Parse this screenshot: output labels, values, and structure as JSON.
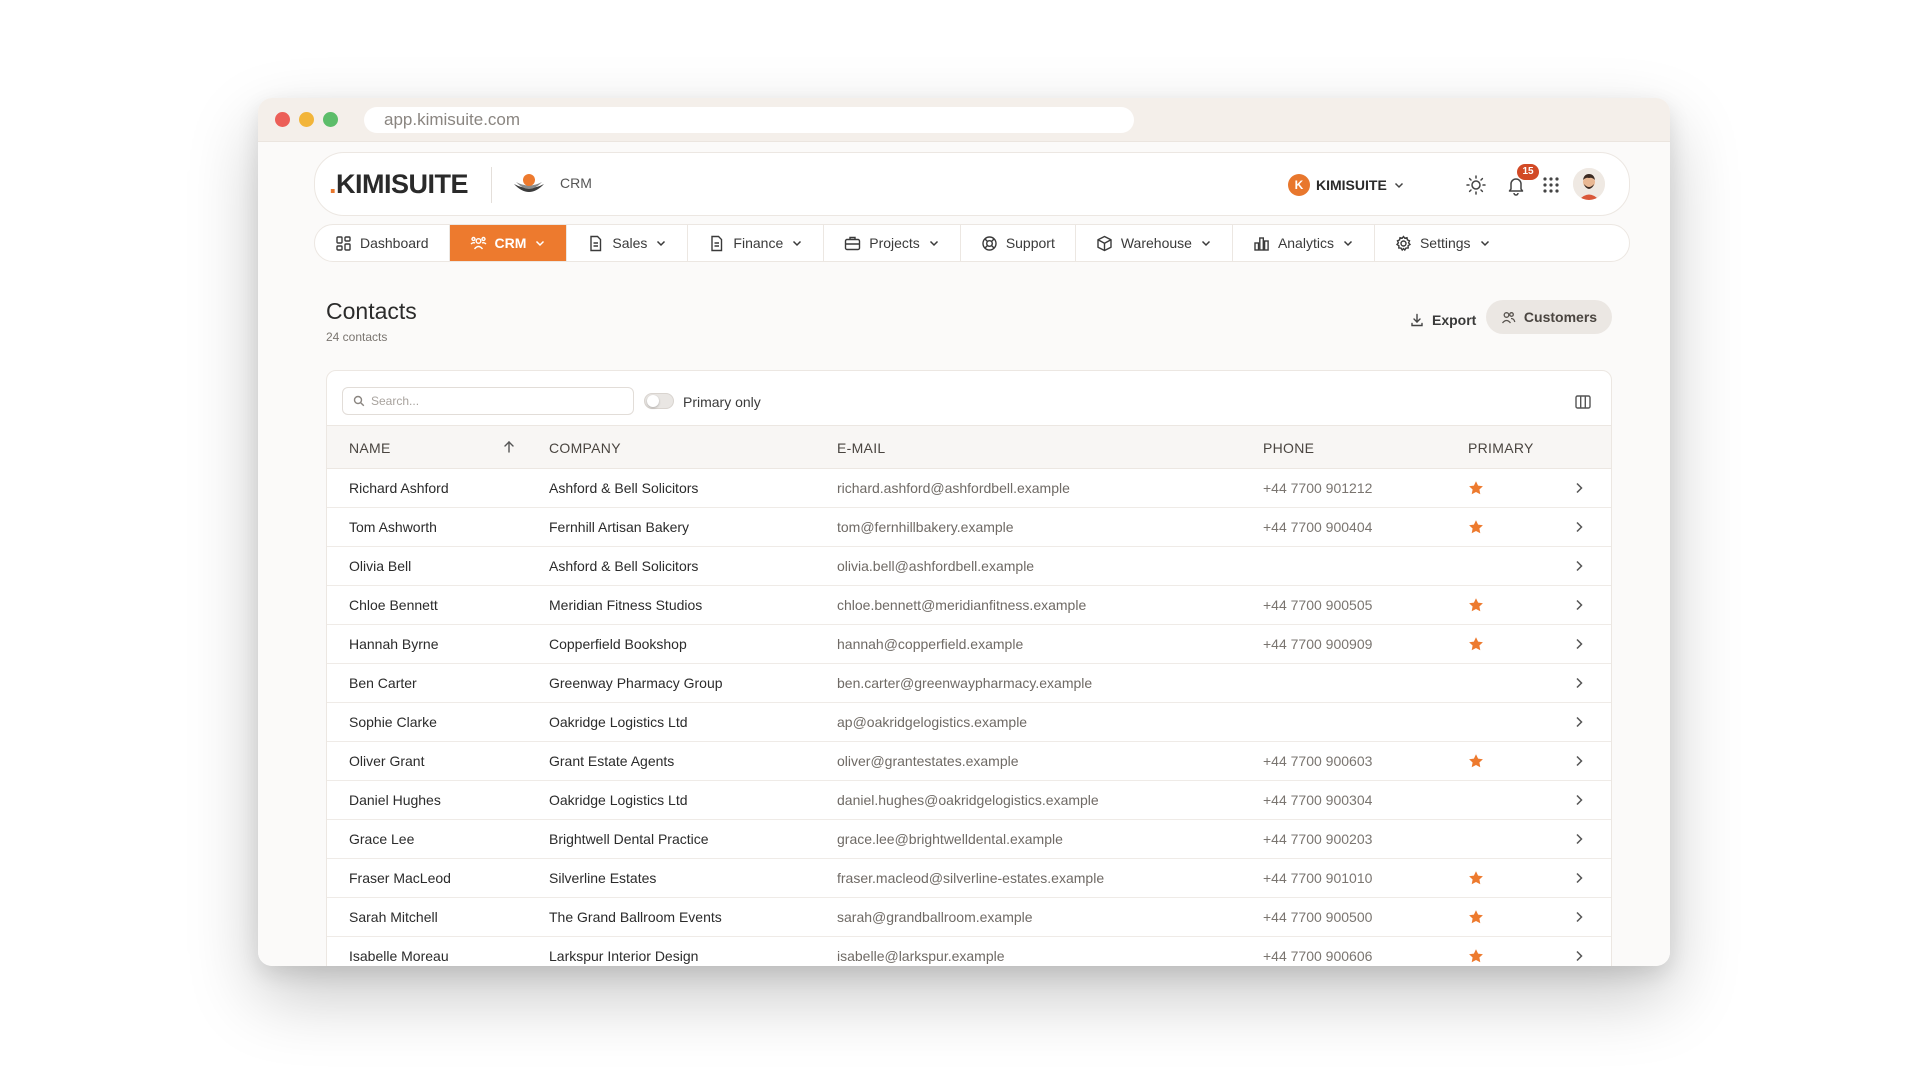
{
  "browser": {
    "url": "app.kimisuite.com"
  },
  "header": {
    "logo_dot": ".",
    "logo_text": "KIMISUITE",
    "module_label": "CRM",
    "tenant_initial": "K",
    "tenant_name": "KIMISUITE",
    "notification_count": "15",
    "icons": [
      "sun-icon",
      "bell-icon",
      "apps-grid-icon"
    ]
  },
  "nav": {
    "items": [
      {
        "label": "Dashboard",
        "icon": "dashboard-icon"
      },
      {
        "label": "CRM",
        "icon": "people-icon"
      },
      {
        "label": "Sales",
        "icon": "document-icon"
      },
      {
        "label": "Finance",
        "icon": "document-icon"
      },
      {
        "label": "Projects",
        "icon": "briefcase-icon"
      },
      {
        "label": "Support",
        "icon": "lifebuoy-icon"
      },
      {
        "label": "Warehouse",
        "icon": "box-icon"
      },
      {
        "label": "Analytics",
        "icon": "bar-chart-icon"
      },
      {
        "label": "Settings",
        "icon": "gear-icon"
      }
    ],
    "active": "CRM"
  },
  "page": {
    "title": "Contacts",
    "subtitle": "24 contacts",
    "export_label": "Export",
    "customers_label": "Customers"
  },
  "toolbar": {
    "search_placeholder": "Search...",
    "search_value": "",
    "toggle_label": "Primary only",
    "toggle_on": false
  },
  "table": {
    "columns": [
      "NAME",
      "COMPANY",
      "E-MAIL",
      "PHONE",
      "PRIMARY"
    ],
    "sort": {
      "column": "NAME",
      "direction": "asc"
    },
    "rows": [
      {
        "name": "Richard Ashford",
        "company": "Ashford & Bell Solicitors",
        "email": "richard.ashford@ashfordbell.example",
        "phone": "+44 7700 901212",
        "primary": true
      },
      {
        "name": "Tom Ashworth",
        "company": "Fernhill Artisan Bakery",
        "email": "tom@fernhillbakery.example",
        "phone": "+44 7700 900404",
        "primary": true
      },
      {
        "name": "Olivia Bell",
        "company": "Ashford & Bell Solicitors",
        "email": "olivia.bell@ashfordbell.example",
        "phone": "",
        "primary": false
      },
      {
        "name": "Chloe Bennett",
        "company": "Meridian Fitness Studios",
        "email": "chloe.bennett@meridianfitness.example",
        "phone": "+44 7700 900505",
        "primary": true
      },
      {
        "name": "Hannah Byrne",
        "company": "Copperfield Bookshop",
        "email": "hannah@copperfield.example",
        "phone": "+44 7700 900909",
        "primary": true
      },
      {
        "name": "Ben Carter",
        "company": "Greenway Pharmacy Group",
        "email": "ben.carter@greenwaypharmacy.example",
        "phone": "",
        "primary": false
      },
      {
        "name": "Sophie Clarke",
        "company": "Oakridge Logistics Ltd",
        "email": "ap@oakridgelogistics.example",
        "phone": "",
        "primary": false
      },
      {
        "name": "Oliver Grant",
        "company": "Grant Estate Agents",
        "email": "oliver@grantestates.example",
        "phone": "+44 7700 900603",
        "primary": true
      },
      {
        "name": "Daniel Hughes",
        "company": "Oakridge Logistics Ltd",
        "email": "daniel.hughes@oakridgelogistics.example",
        "phone": "+44 7700 900304",
        "primary": false
      },
      {
        "name": "Grace Lee",
        "company": "Brightwell Dental Practice",
        "email": "grace.lee@brightwelldental.example",
        "phone": "+44 7700 900203",
        "primary": false
      },
      {
        "name": "Fraser MacLeod",
        "company": "Silverline Estates",
        "email": "fraser.macleod@silverline-estates.example",
        "phone": "+44 7700 901010",
        "primary": true
      },
      {
        "name": "Sarah Mitchell",
        "company": "The Grand Ballroom Events",
        "email": "sarah@grandballroom.example",
        "phone": "+44 7700 900500",
        "primary": true
      },
      {
        "name": "Isabelle Moreau",
        "company": "Larkspur Interior Design",
        "email": "isabelle@larkspur.example",
        "phone": "+44 7700 900606",
        "primary": true
      }
    ]
  },
  "colors": {
    "accent": "#ed7a2e",
    "badge": "#d24a26",
    "background": "#fbfaf9"
  }
}
